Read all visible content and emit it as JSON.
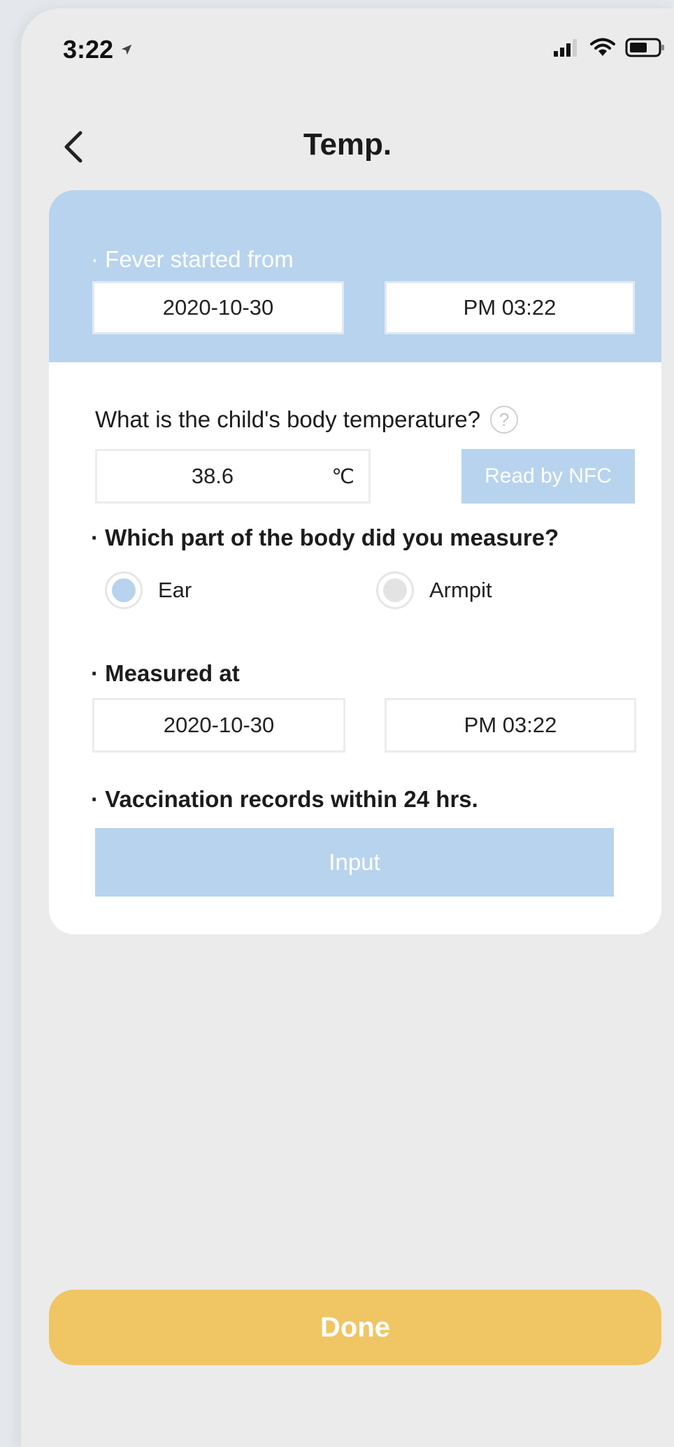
{
  "status_bar": {
    "time": "3:22"
  },
  "header": {
    "title": "Temp."
  },
  "fever": {
    "label": "· Fever started from",
    "date": "2020-10-30",
    "time": "PM 03:22"
  },
  "temperature": {
    "question": "What is the child's body temperature?",
    "help": "?",
    "value": "38.6",
    "unit": "℃",
    "nfc_label": "Read by NFC"
  },
  "body_part": {
    "question": "· Which part of the body did you measure?",
    "options": [
      {
        "label": "Ear",
        "selected": true
      },
      {
        "label": "Armpit",
        "selected": false
      }
    ]
  },
  "measured": {
    "label": "· Measured at",
    "date": "2020-10-30",
    "time": "PM 03:22"
  },
  "vaccination": {
    "label": "· Vaccination records within 24 hrs.",
    "input_label": "Input"
  },
  "done_label": "Done",
  "colors": {
    "accent_blue": "#b8d3ed",
    "done_yellow": "#f0c564",
    "radio_selected": "#b8d3ed",
    "radio_unselected": "#e3e3e3"
  }
}
